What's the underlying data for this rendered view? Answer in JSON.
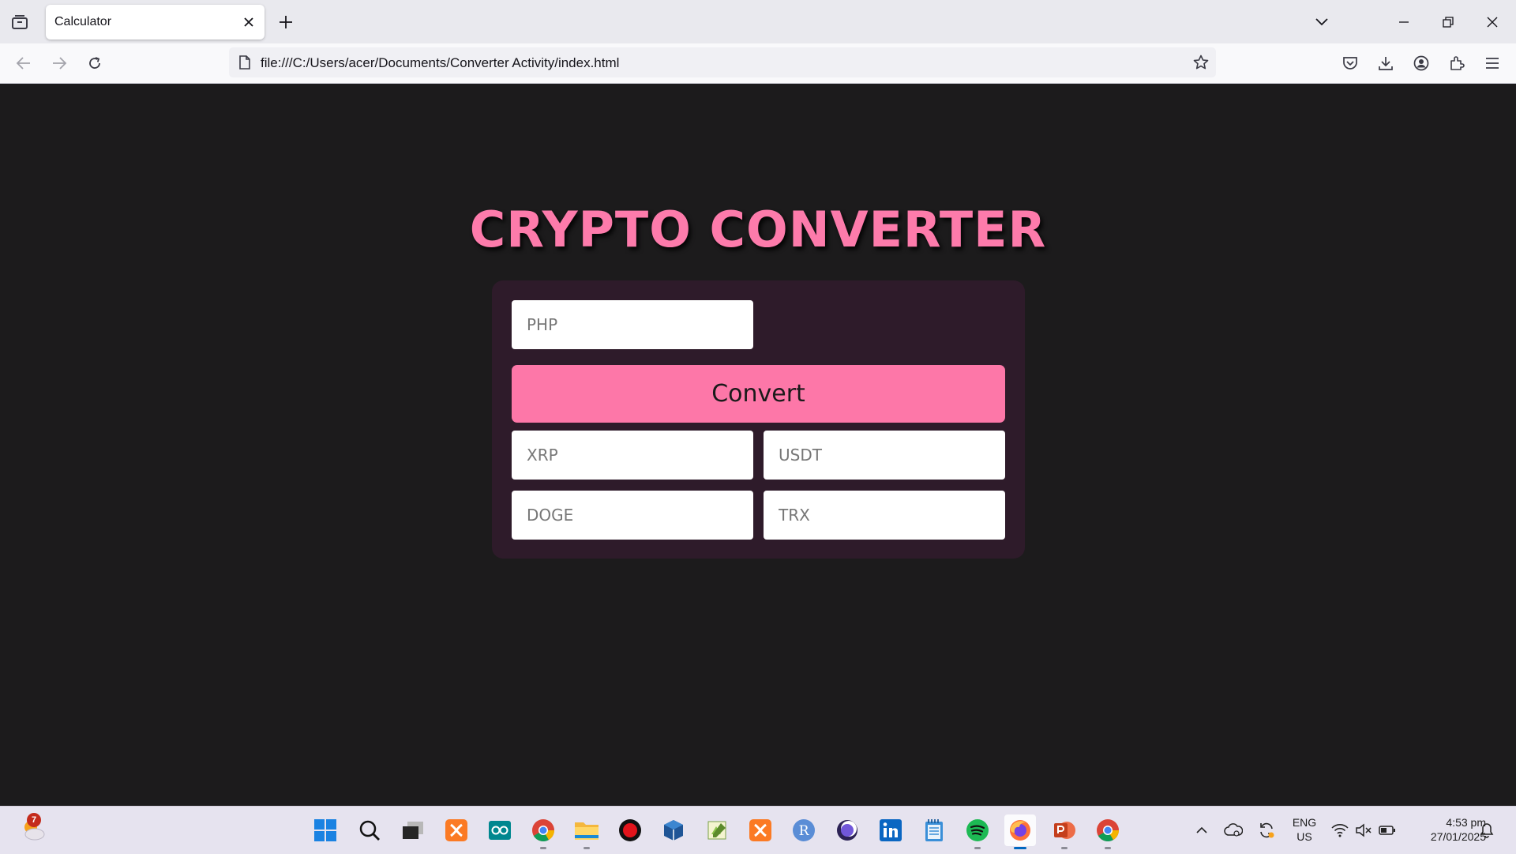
{
  "browser": {
    "tab_title": "Calculator",
    "url": "file:///C:/Users/acer/Documents/Converter Activity/index.html"
  },
  "page": {
    "heading": "CRYPTO CONVERTER",
    "php_placeholder": "PHP",
    "convert_label": "Convert",
    "xrp_placeholder": "XRP",
    "usdt_placeholder": "USDT",
    "doge_placeholder": "DOGE",
    "trx_placeholder": "TRX"
  },
  "taskbar": {
    "weather_badge": "7",
    "apps": [
      "start-menu",
      "search",
      "task-view",
      "xampp",
      "arduino-ide",
      "chrome",
      "file-explorer",
      "obs-studio",
      "virtualbox",
      "notepad-plus-plus",
      "xampp-2",
      "r-app",
      "eclipse",
      "linkedin",
      "notepad",
      "spotify",
      "firefox",
      "powerpoint",
      "chrome-2"
    ],
    "language": "ENG",
    "region": "US",
    "time": "4:53 pm",
    "date": "27/01/2025"
  },
  "colors": {
    "accent_pink": "#fd77a8",
    "panel": "#2e1b2a",
    "background": "#1c1b1c"
  }
}
